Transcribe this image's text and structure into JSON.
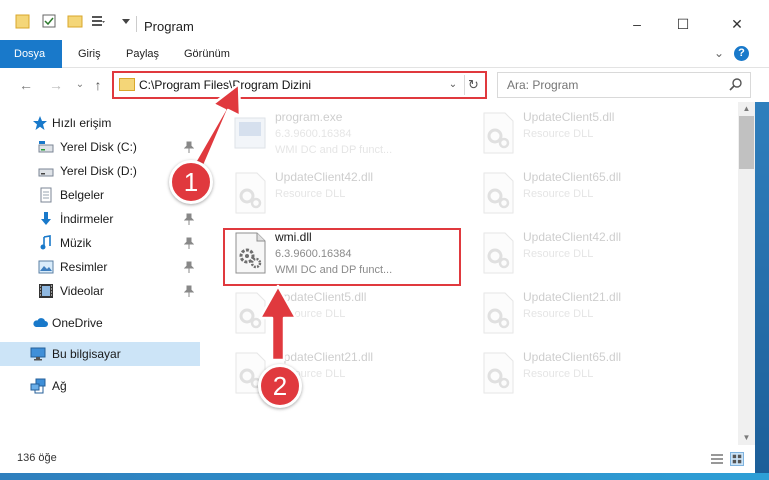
{
  "window": {
    "title": "Program",
    "minimize_glyph": "–",
    "maximize_glyph": "☐",
    "close_glyph": "✕",
    "help_glyph": "?",
    "ribbon_expand_glyph": "⌄"
  },
  "ribbon": {
    "tabs": [
      {
        "label": "Dosya",
        "active": true
      },
      {
        "label": "Giriş",
        "active": false
      },
      {
        "label": "Paylaş",
        "active": false
      },
      {
        "label": "Görünüm",
        "active": false
      }
    ]
  },
  "address": {
    "path": "C:\\Program Files\\Program Dizini",
    "back_glyph": "←",
    "forward_glyph": "→",
    "recent_glyph": "⌄",
    "up_glyph": "↑",
    "dropdown_glyph": "⌄",
    "refresh_glyph": "↻"
  },
  "search": {
    "placeholder": "Ara: Program"
  },
  "sidebar": {
    "items": [
      {
        "label": "Hızlı erişim",
        "icon": "star-icon",
        "pinned": false
      },
      {
        "label": "Yerel Disk (C:)",
        "icon": "drive-icon",
        "pinned": true
      },
      {
        "label": "Yerel Disk (D:)",
        "icon": "drive-icon",
        "pinned": false
      },
      {
        "label": "Belgeler",
        "icon": "documents-icon",
        "pinned": false
      },
      {
        "label": "İndirmeler",
        "icon": "download-icon",
        "pinned": true
      },
      {
        "label": "Müzik",
        "icon": "music-icon",
        "pinned": true
      },
      {
        "label": "Resimler",
        "icon": "pictures-icon",
        "pinned": true
      },
      {
        "label": "Videolar",
        "icon": "video-icon",
        "pinned": true
      },
      {
        "label": "OneDrive",
        "icon": "cloud-icon",
        "pinned": false
      },
      {
        "label": "Bu bilgisayar",
        "icon": "computer-icon",
        "pinned": false,
        "selected": true
      },
      {
        "label": "Ağ",
        "icon": "network-icon",
        "pinned": false
      }
    ]
  },
  "files": {
    "left": [
      {
        "name": "program.exe",
        "sub1": "6.3.9600.16384",
        "sub2": "WMI DC and DP funct...",
        "faded": true
      },
      {
        "name": "UpdateClient42.dll",
        "sub1": "Resource DLL",
        "sub2": "",
        "faded": true
      },
      {
        "name": "wmi.dll",
        "sub1": "6.3.9600.16384",
        "sub2": "WMI DC and DP funct...",
        "faded": false,
        "highlighted": true
      },
      {
        "name": "UpdateClient5.dll",
        "sub1": "Resource DLL",
        "sub2": "",
        "faded": true
      },
      {
        "name": "UpdateClient21.dll",
        "sub1": "Resource DLL",
        "sub2": "",
        "faded": true
      }
    ],
    "right": [
      {
        "name": "UpdateClient5.dll",
        "sub1": "Resource DLL",
        "faded": true
      },
      {
        "name": "UpdateClient65.dll",
        "sub1": "Resource DLL",
        "faded": true
      },
      {
        "name": "UpdateClient42.dll",
        "sub1": "Resource DLL",
        "faded": true
      },
      {
        "name": "UpdateClient21.dll",
        "sub1": "Resource DLL",
        "faded": true
      },
      {
        "name": "UpdateClient65.dll",
        "sub1": "Resource DLL",
        "faded": true
      }
    ]
  },
  "callouts": {
    "one": "1",
    "two": "2"
  },
  "status": {
    "count": "136 öğe"
  },
  "colors": {
    "accent": "#1979ca",
    "highlight": "#e0393e",
    "selection": "#cce4f7"
  }
}
